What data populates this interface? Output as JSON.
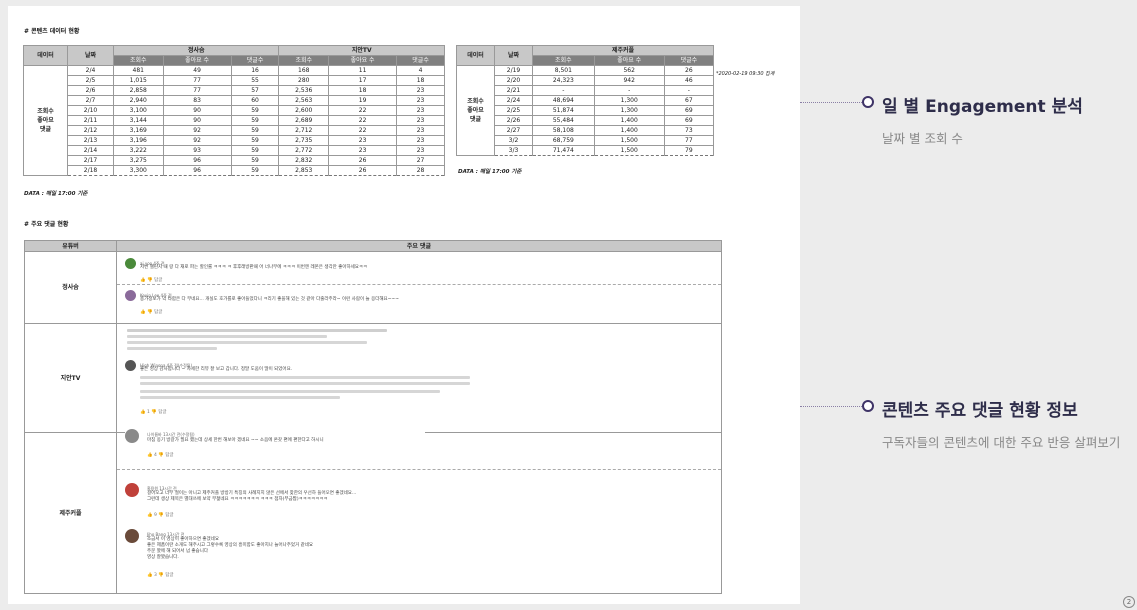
{
  "section1_title": "# 콘텐츠 데이터 현황",
  "table1": {
    "col_data": "데이터",
    "col_date": "날짜",
    "groups": [
      "정사슴",
      "지안TV"
    ],
    "sub_headers": [
      "조회수",
      "좋아요 수",
      "댓글수",
      "조회수",
      "좋아요 수",
      "댓글수"
    ],
    "row_label": "조회수\n좋아요\n댓글",
    "rows": [
      [
        "2/4",
        "481",
        "49",
        "16",
        "168",
        "11",
        "4"
      ],
      [
        "2/5",
        "1,015",
        "77",
        "55",
        "280",
        "17",
        "18"
      ],
      [
        "2/6",
        "2,858",
        "77",
        "57",
        "2,536",
        "18",
        "23"
      ],
      [
        "2/7",
        "2,940",
        "83",
        "60",
        "2,563",
        "19",
        "23"
      ],
      [
        "2/10",
        "3,100",
        "90",
        "59",
        "2,600",
        "22",
        "23"
      ],
      [
        "2/11",
        "3,144",
        "90",
        "59",
        "2,689",
        "22",
        "23"
      ],
      [
        "2/12",
        "3,169",
        "92",
        "59",
        "2,712",
        "22",
        "23"
      ],
      [
        "2/13",
        "3,196",
        "92",
        "59",
        "2,735",
        "23",
        "23"
      ],
      [
        "2/14",
        "3,222",
        "93",
        "59",
        "2,772",
        "23",
        "23"
      ],
      [
        "2/17",
        "3,275",
        "96",
        "59",
        "2,832",
        "26",
        "27"
      ],
      [
        "2/18",
        "3,300",
        "96",
        "59",
        "2,853",
        "26",
        "28"
      ]
    ]
  },
  "table1_note": "DATA : 매일 17:00 기준",
  "table2": {
    "col_data": "데이터",
    "col_date": "날짜",
    "group": "제주커플",
    "sub_headers": [
      "조회수",
      "좋아요 수",
      "댓글수"
    ],
    "row_label": "조회수\n좋아요\n댓글",
    "rows": [
      [
        "2/19",
        "8,501",
        "562",
        "26"
      ],
      [
        "2/20",
        "24,323",
        "942",
        "46"
      ],
      [
        "2/21",
        "-",
        "-",
        "-"
      ],
      [
        "2/24",
        "48,694",
        "1,300",
        "67"
      ],
      [
        "2/25",
        "51,874",
        "1,300",
        "69"
      ],
      [
        "2/26",
        "55,484",
        "1,400",
        "69"
      ],
      [
        "2/27",
        "58,108",
        "1,400",
        "73"
      ],
      [
        "3/2",
        "68,759",
        "1,500",
        "77"
      ],
      [
        "3/3",
        "71,474",
        "1,500",
        "79"
      ]
    ]
  },
  "table2_note": "DATA : 매일 17:00 기준",
  "table2_side_note": "*2020-02-19 09:30 집계",
  "section2_title": "# 주요 댓글 현황",
  "comments_table": {
    "col_youtuber": "유튜버",
    "col_comments": "주요 댓글",
    "rows": [
      {
        "youtuber": "정사슴",
        "comments": [
          {
            "name": "ai yoo 4주 전",
            "text": "저번 챌린지 때 랑 다 재로 파는 할인률 ㅋㅋㅋ ㅋ 후후래방판때 어 너나무에 ㅋㅋㅋ 이번엔 레몬은 생각만 좋아하세요ㅋㅋ",
            "actions": "👍  👎   답글",
            "avatar_color": "#4a8a3a"
          },
          {
            "name": "Kevin Lee 4주 전",
            "text": "용가정보가 약 타합은 다 부네요... 개실도 호가를로 좋아들었다니 ㅋ리기 좋을해 있는 것 같아 다줄라주라~ 이런 사람이 늘 응더해요~~~",
            "actions": "👍  👎   답글",
            "avatar_color": "#8a6a9a"
          }
        ]
      },
      {
        "youtuber": "지안TV",
        "comments": [
          {
            "name": "High Winona 4주 전(수정됨)",
            "text": "좋은 영상 감사합니다 ~ 자세한 리뷰 잘 보고 갑니다. 정말 도움이 많이 되었어요.",
            "actions": "👍 1  👎   답글",
            "avatar_color": "#555"
          },
          {
            "name": "나이름바 13시간 전(수정됨)",
            "text": "마침 옹기 방갈가 필요 했는데 상세 한번 해보아 겠네요 ~~   소음에 온갖 편에 편한다고 하시니",
            "actions": "👍 4  👎   답글",
            "avatar_color": "#8a8a8a"
          }
        ]
      },
      {
        "youtuber": "제주커플",
        "comments": [
          {
            "name": "홍용원 13시간 전",
            "text": "걸어오고 너무 절이는 아니고 제주커플 방방기 특징의 사례지지 않은 선에서 찾한의 우선하 들어오면 좋겠네요...\n그런데 생상 제목은 별대쓰에 보약 부젊네요 ㅋㅋㅋㅋㅋㅋㅋ ㅋㅋㅋ 점자(부금짭)ㅋㅋㅋㅋㅋㅋㅋ",
            "actions": "👍 9  👎   답글",
            "avatar_color": "#c0413a"
          },
          {
            "name": "Jiho Bang 13시간 전",
            "text": "조금서 이 영상이 좋아하으면 좋겠네요\n좋은 제품이란 소개도 해주시고 그렇수록 영상의 흥미함도 좋아지나 늘어나주었거 같네요\n주문 봤에 해 되어서 넘 좋습니다\n영상 잘봤습니다.",
            "actions": "👍 3  👎   답글",
            "avatar_color": "#6a4a3a"
          }
        ]
      }
    ]
  },
  "right_panel": {
    "item1_title": "일 별 Engagement 분석",
    "item1_sub": "날짜 별 조회 수",
    "item2_title": "콘텐츠 주요 댓글 현황 정보",
    "item2_sub": "구독자들의 콘텐츠에 대한 주요 반응 살펴보기"
  },
  "page_number": "2"
}
